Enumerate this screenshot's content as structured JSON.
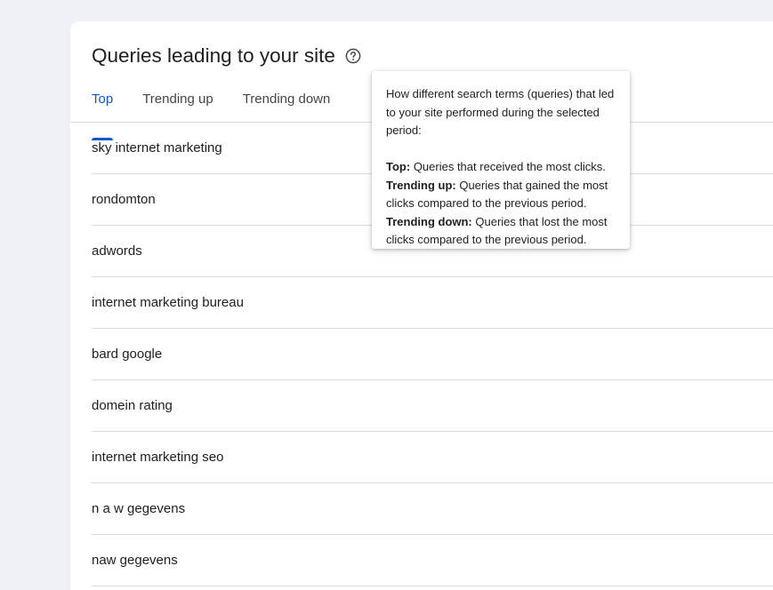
{
  "card": {
    "title": "Queries leading to your site",
    "help_icon": "help-circle-icon"
  },
  "tabs": [
    {
      "label": "Top",
      "active": true
    },
    {
      "label": "Trending up",
      "active": false
    },
    {
      "label": "Trending down",
      "active": false
    }
  ],
  "queries": [
    "sky internet marketing",
    "rondomton",
    "adwords",
    "internet marketing bureau",
    "bard google",
    "domein rating",
    "internet marketing seo",
    "n a w gegevens",
    "naw gegevens"
  ],
  "tooltip": {
    "intro": "How different search terms (queries) that led to your site performed during the selected period:",
    "items": [
      {
        "term": "Top:",
        "desc": "Queries that received the most clicks."
      },
      {
        "term": "Trending up:",
        "desc": "Queries that gained the most clicks compared to the previous period."
      },
      {
        "term": "Trending down:",
        "desc": "Queries that lost the most clicks compared to the previous period."
      }
    ]
  },
  "colors": {
    "accent": "#0b57d0",
    "background": "#eef1f6",
    "card": "#ffffff",
    "divider": "#dadce0"
  }
}
